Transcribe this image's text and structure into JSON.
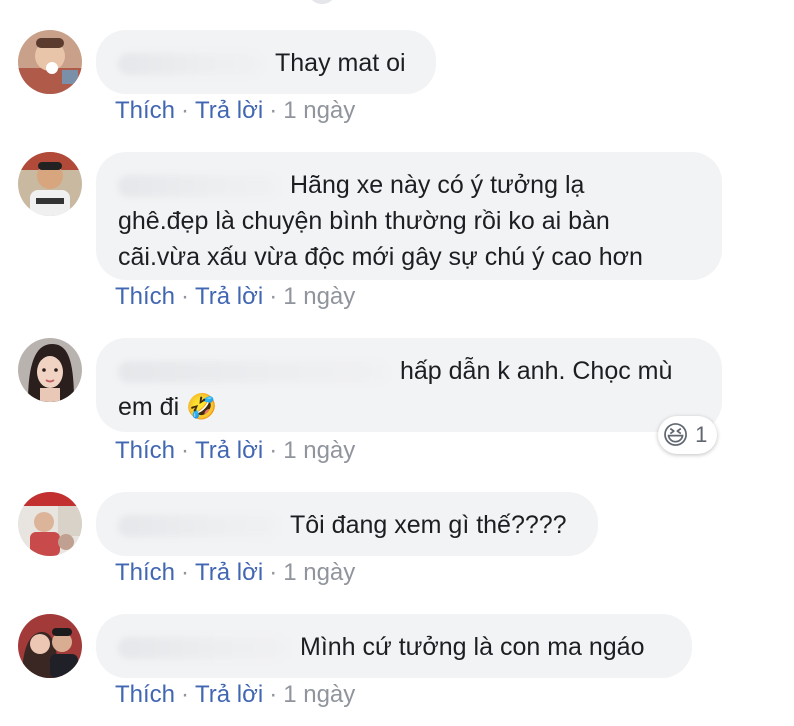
{
  "comments": [
    {
      "text": "Thay mat oi",
      "actions": {
        "like": "Thích",
        "reply": "Trả lời",
        "time": "1 ngày"
      }
    },
    {
      "text": "Hãng xe này có ý tưởng lạ ghê.đẹp là chuyện bình thường rồi ko ai bàn cãi.vừa xấu vừa độc mới gây sự chú ý cao hơn",
      "line1": "Hãng xe này có ý tưởng lạ",
      "line2": "ghê.đẹp là chuyện bình thường rồi ko ai bàn",
      "line3": "cãi.vừa xấu vừa độc mới gây sự chú ý cao hơn",
      "actions": {
        "like": "Thích",
        "reply": "Trả lời",
        "time": "1 ngày"
      }
    },
    {
      "text": "hấp dẫn k anh. Chọc mù em đi 🤣",
      "line1": "hấp dẫn k anh. Chọc mù",
      "line2": "em đi",
      "emoji": "🤣",
      "reaction": {
        "emoji": "😆",
        "count": "1"
      },
      "actions": {
        "like": "Thích",
        "reply": "Trả lời",
        "time": "1 ngày"
      }
    },
    {
      "text": "Tôi đang xem gì thế????",
      "actions": {
        "like": "Thích",
        "reply": "Trả lời",
        "time": "1 ngày"
      }
    },
    {
      "text": "Mình cứ tưởng là con ma ngáo",
      "actions": {
        "like": "Thích",
        "reply": "Trả lời",
        "time": "1 ngày"
      }
    }
  ],
  "separator": "·",
  "colors": {
    "link": "#4267b2",
    "meta": "#90949c",
    "bubble": "#f2f3f5",
    "text": "#1c1e21"
  }
}
